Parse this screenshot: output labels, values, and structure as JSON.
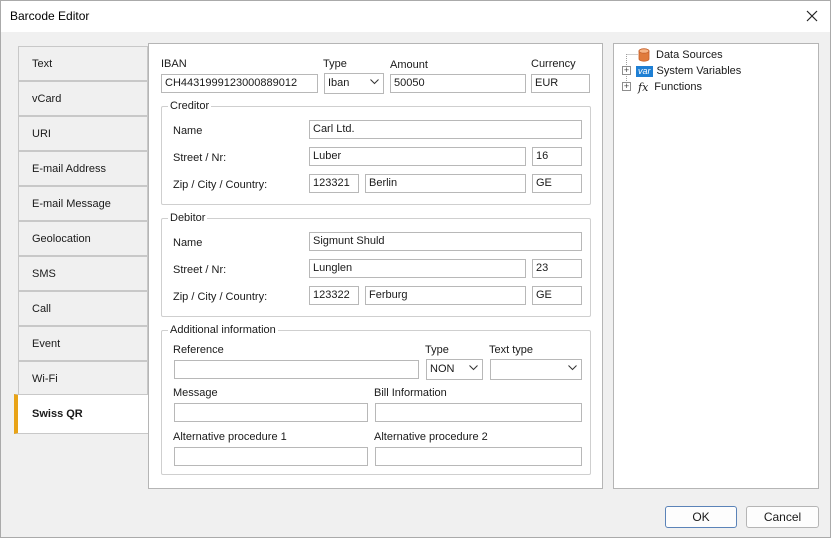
{
  "window": {
    "title": "Barcode Editor"
  },
  "tabs": [
    {
      "label": "Text"
    },
    {
      "label": "vCard"
    },
    {
      "label": "URI"
    },
    {
      "label": "E-mail Address"
    },
    {
      "label": "E-mail Message"
    },
    {
      "label": "Geolocation"
    },
    {
      "label": "SMS"
    },
    {
      "label": "Call"
    },
    {
      "label": "Event"
    },
    {
      "label": "Wi-Fi"
    },
    {
      "label": "Swiss QR"
    }
  ],
  "active_tab": "Swiss QR",
  "form": {
    "iban_label": "IBAN",
    "iban_value": "CH4431999123000889012",
    "type_label": "Type",
    "type_value": "Iban",
    "amount_label": "Amount",
    "amount_value": "50050",
    "currency_label": "Currency",
    "currency_value": "EUR",
    "creditor": {
      "title": "Creditor",
      "name_label": "Name",
      "name_value": "Carl Ltd.",
      "street_label": "Street / Nr:",
      "street_value": "Luber",
      "nr_value": "16",
      "zip_label": "Zip / City / Country:",
      "zip_value": "123321",
      "city_value": "Berlin",
      "country_value": "GE"
    },
    "debitor": {
      "title": "Debitor",
      "name_label": "Name",
      "name_value": "Sigmunt Shuld",
      "street_label": "Street / Nr:",
      "street_value": "Lunglen",
      "nr_value": "23",
      "zip_label": "Zip / City / Country:",
      "zip_value": "123322",
      "city_value": "Ferburg",
      "country_value": "GE"
    },
    "additional": {
      "title": "Additional information",
      "reference_label": "Reference",
      "reference_value": "",
      "type_label": "Type",
      "type_value": "NON",
      "text_type_label": "Text type",
      "text_type_value": "",
      "message_label": "Message",
      "message_value": "",
      "bill_info_label": "Bill Information",
      "bill_info_value": "",
      "alt1_label": "Alternative procedure 1",
      "alt1_value": "",
      "alt2_label": "Alternative procedure 2",
      "alt2_value": ""
    }
  },
  "tree": {
    "items": [
      {
        "label": "Data Sources",
        "icon": "database-icon"
      },
      {
        "label": "System Variables",
        "icon": "var-icon",
        "icon_text": "var"
      },
      {
        "label": "Functions",
        "icon": "function-icon",
        "icon_text": "fx"
      }
    ]
  },
  "buttons": {
    "ok": "OK",
    "cancel": "Cancel"
  },
  "colors": {
    "active_tab_accent": "#e8a317",
    "var_badge": "#1e7fd4",
    "database": "#e07b3c"
  }
}
